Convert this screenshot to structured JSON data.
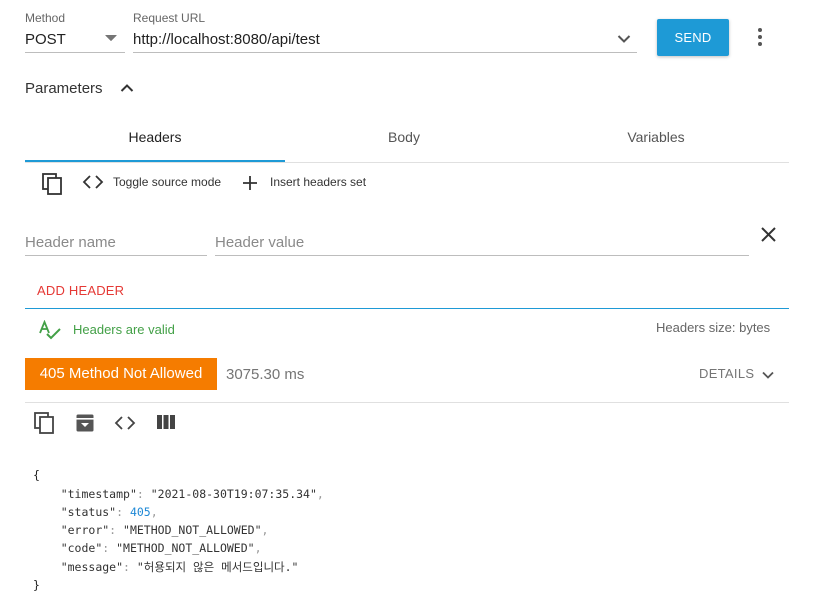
{
  "request": {
    "method_label": "Method",
    "method_value": "POST",
    "url_label": "Request URL",
    "url_value": "http://localhost:8080/api/test",
    "send_label": "SEND"
  },
  "parameters": {
    "title": "Parameters",
    "tabs": [
      {
        "label": "Headers",
        "active": true
      },
      {
        "label": "Body",
        "active": false
      },
      {
        "label": "Variables",
        "active": false
      }
    ]
  },
  "headers_toolbar": {
    "toggle_source": "Toggle source mode",
    "insert_set": "Insert headers set"
  },
  "header_form": {
    "name_placeholder": "Header name",
    "value_placeholder": "Header value",
    "add_label": "ADD HEADER"
  },
  "validation": {
    "valid_text": "Headers are valid",
    "size_text": "Headers size: bytes"
  },
  "response": {
    "status_text": "405 Method Not Allowed",
    "time_text": "3075.30 ms",
    "details_label": "DETAILS"
  },
  "response_body": {
    "open": "{",
    "close": "}",
    "fields": [
      {
        "key": "\"timestamp\"",
        "value": "\"2021-08-30T19:07:35.34\"",
        "type": "string"
      },
      {
        "key": "\"status\"",
        "value": "405",
        "type": "number"
      },
      {
        "key": "\"error\"",
        "value": "\"METHOD_NOT_ALLOWED\"",
        "type": "string"
      },
      {
        "key": "\"code\"",
        "value": "\"METHOD_NOT_ALLOWED\"",
        "type": "string"
      },
      {
        "key": "\"message\"",
        "value": "\"허용되지 않은 메서드입니다.\"",
        "type": "string"
      }
    ]
  },
  "colors": {
    "accent": "#1e9ad6",
    "status_error": "#f57c00",
    "valid_green": "#43a047",
    "add_header_red": "#e53935"
  },
  "icons": [
    "chevron-down-icon",
    "more-vert-icon",
    "chevron-up-icon",
    "copy-icon",
    "code-icon",
    "add-icon",
    "close-icon",
    "spellcheck-icon",
    "archive-icon",
    "columns-icon"
  ]
}
